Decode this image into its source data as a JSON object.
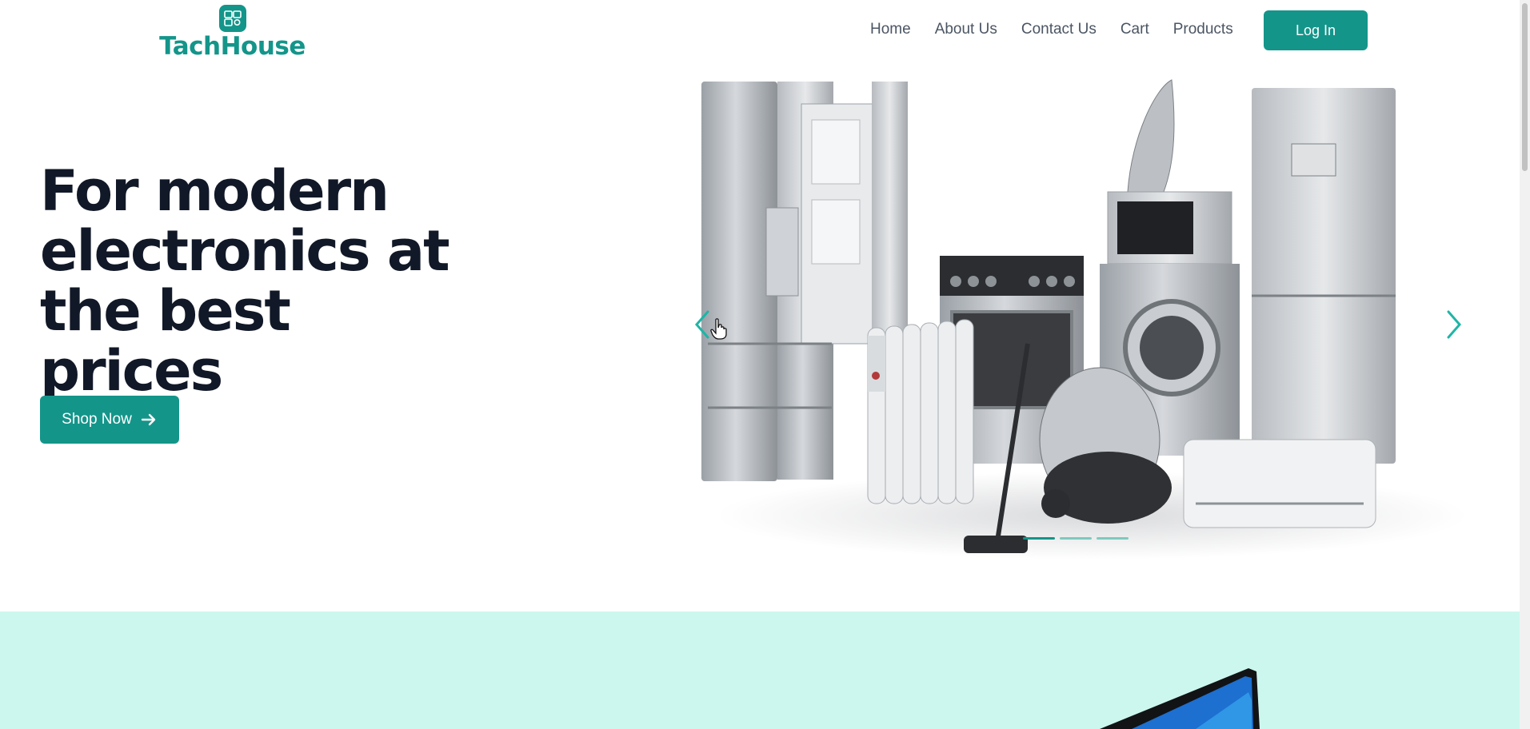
{
  "brand": {
    "name": "TachHouse",
    "color": "#14958a"
  },
  "nav": {
    "items": [
      {
        "label": "Home"
      },
      {
        "label": "About Us"
      },
      {
        "label": "Contact Us"
      },
      {
        "label": "Cart"
      },
      {
        "label": "Products"
      }
    ],
    "login_label": "Log In"
  },
  "hero": {
    "title": "For modern electronics at the best prices",
    "cta_label": "Shop Now",
    "cta_icon": "arrow-right-icon"
  },
  "carousel": {
    "image_alt": "home appliances",
    "prev_icon": "chevron-left-icon",
    "next_icon": "chevron-right-icon",
    "slide_count": 3,
    "active_slide": 1
  },
  "colors": {
    "accent": "#14958a",
    "section_bg": "#ccf7ee",
    "heading": "#111827"
  }
}
